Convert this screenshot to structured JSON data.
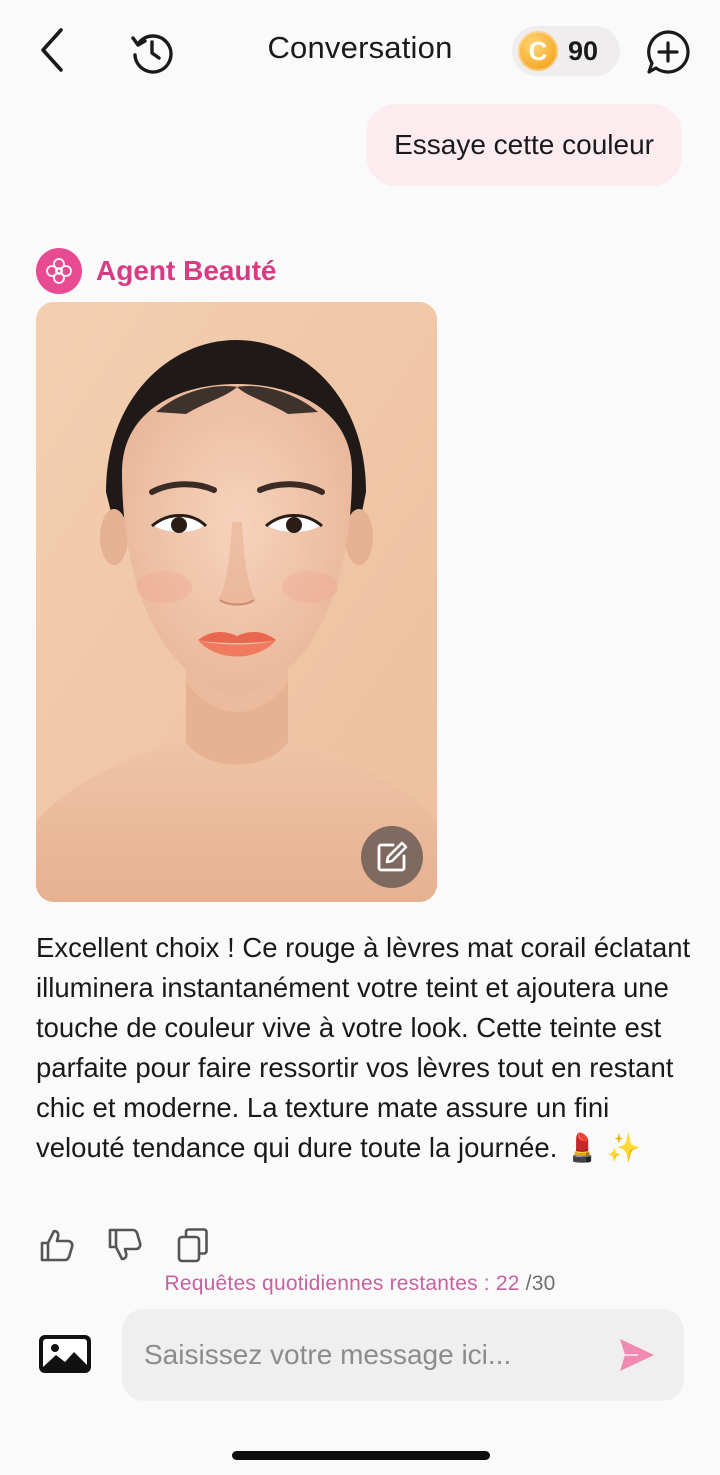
{
  "header": {
    "back_icon": "chevron-left-icon",
    "history_icon": "history-clock-icon",
    "title": "Conversation",
    "coins": {
      "symbol": "C",
      "count": "90"
    },
    "new_chat_icon": "chat-plus-icon"
  },
  "user_message": "Essaye cette couleur",
  "agent": {
    "name": "Agent Beauté",
    "avatar_icon": "flower-icon",
    "image_edit_icon": "edit-icon",
    "message": "Excellent choix ! Ce rouge à lèvres mat corail éclatant illuminera instantanément votre teint et ajoutera une touche de couleur vive à votre look. Cette teinte est parfaite pour faire ressortir vos lèvres tout en restant chic et moderne. La texture mate assure un fini velouté tendance qui dure toute la journée. 💄 ✨"
  },
  "feedback": {
    "like_icon": "thumbs-up-icon",
    "dislike_icon": "thumbs-down-icon",
    "copy_icon": "copy-icon"
  },
  "quota": {
    "label": "Requêtes quotidiennes restantes : 22",
    "total": " /30"
  },
  "composer": {
    "placeholder": "Saisissez votre message ici...",
    "gallery_icon": "image-icon",
    "send_icon": "send-icon"
  },
  "colors": {
    "accent": "#d83b84",
    "user_bubble": "#fcecef",
    "send": "#f08ab3"
  }
}
